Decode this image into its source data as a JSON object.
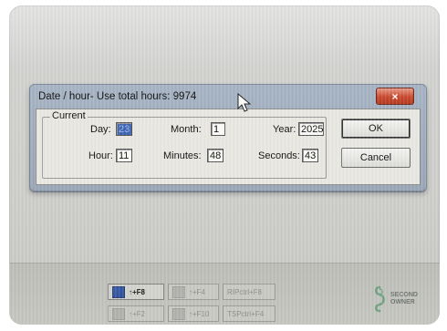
{
  "dialog": {
    "title": "Date / hour- Use total hours: 9974",
    "close_symbol": "×",
    "group_label": "Current",
    "fields": {
      "day": {
        "label": "Day:",
        "value": "23"
      },
      "month": {
        "label": "Month:",
        "value": "1"
      },
      "year": {
        "label": "Year:",
        "value": "2025"
      },
      "hour": {
        "label": "Hour:",
        "value": "11"
      },
      "minutes": {
        "label": "Minutes:",
        "value": "48"
      },
      "seconds": {
        "label": "Seconds:",
        "value": "43"
      }
    },
    "buttons": {
      "ok": "OK",
      "cancel": "Cancel"
    }
  },
  "toolbar": {
    "btn1": "↑+F8",
    "btn2": "↑+F4",
    "btn3": "RIPctrl+F8",
    "btn4": "↑+F2",
    "btn5": "↑+F10",
    "btn6": "TSPctrl+F4"
  },
  "watermark": {
    "line1": "SECOND",
    "line2": "OWNER"
  },
  "colors": {
    "selection": "#3b63b3",
    "close_red": "#c9472c",
    "title_bar": "#a7b4c4"
  }
}
